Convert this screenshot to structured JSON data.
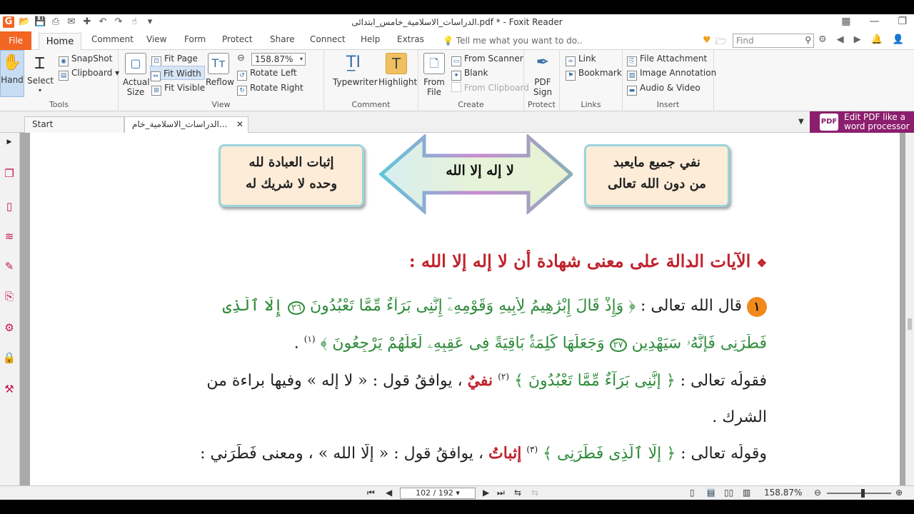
{
  "window": {
    "title": "الدراسات_الاسلامية_خامس_ابتدائى.pdf * - Foxit Reader"
  },
  "ribbon_tabs": {
    "file": "File",
    "home": "Home",
    "comment": "Comment",
    "view": "View",
    "form": "Form",
    "protect": "Protect",
    "share": "Share",
    "connect": "Connect",
    "help": "Help",
    "extras": "Extras",
    "tell_me": "Tell me what you want to do..",
    "search_placeholder": "Find"
  },
  "ribbon": {
    "tools": {
      "label": "Tools",
      "hand": "Hand",
      "select": "Select",
      "snapshot": "SnapShot",
      "clipboard": "Clipboard"
    },
    "view": {
      "label": "View",
      "actual_size": "Actual Size",
      "fit_page": "Fit Page",
      "fit_width": "Fit Width",
      "fit_visible": "Fit Visible",
      "reflow": "Reflow",
      "zoom": "158.87%",
      "rotate_left": "Rotate Left",
      "rotate_right": "Rotate Right"
    },
    "comment": {
      "label": "Comment",
      "typewriter": "Typewriter",
      "highlight": "Highlight"
    },
    "create": {
      "label": "Create",
      "from_file": "From File",
      "from_scanner": "From Scanner",
      "blank": "Blank",
      "from_clipboard": "From Clipboard"
    },
    "protect": {
      "label": "Protect",
      "pdf_sign": "PDF Sign"
    },
    "links": {
      "label": "Links",
      "link": "Link",
      "bookmark": "Bookmark"
    },
    "insert": {
      "label": "Insert",
      "file_attachment": "File Attachment",
      "image_annotation": "Image Annotation",
      "audio_video": "Audio & Video"
    }
  },
  "doc_tabs": {
    "start": "Start",
    "file": "الدراسات_الاسلامية_خام...",
    "promo_line1": "Edit PDF like a",
    "promo_line2": "word processor",
    "promo_icon": "PDF"
  },
  "page": {
    "box_left_line1": "إثبات العبادة لله",
    "box_left_line2": "وحده لا شريك له",
    "arrow_text": "لا إله إلا الله",
    "box_right_line1": "نفي جميع مايعبد",
    "box_right_line2": "من دون الله تعالى",
    "heading": "الآيات الدالة على معنى شهادة أن لا إله إلا الله :",
    "heading_marker": "❖",
    "l1_badge": "١",
    "l1_intro": "قال الله تعالى :",
    "l1_verse": "﴿ وَإِذْ قَالَ إِبْرَٰهِيمُ لِأَبِيهِ وَقَوْمِهِۦٓ إِنَّنِى بَرَآءٌ مِّمَّا تَعْبُدُونَ",
    "l1_ayah": "٢٦",
    "l1_tail": "إِلَّا ٱلَّذِى",
    "l2_verse": "فَطَرَنِى فَإِنَّهُۥ سَيَهْدِينِ",
    "l2_ayah": "٢٧",
    "l2_verse2": "وَجَعَلَهَا كَلِمَةًۢ بَاقِيَةً فِى عَقِبِهِۦ لَعَلَّهُمْ يَرْجِعُونَ ﴾",
    "l2_sup": "(١)",
    "l2_end": ".",
    "l3_intro": "فقولُه تعالى :",
    "l3_verse": "﴿ إِنَّنِى بَرَآءٌ مِّمَّا تَعْبُدُونَ ﴾",
    "l3_sup": "(٢)",
    "l3_red": "نفيٌ",
    "l3_rest": "، يوافقُ قول : « لا إله » وفيها براءة من",
    "l4_text": "الشرك .",
    "l5_intro": "وقولُه تعالى :",
    "l5_verse": "﴿ إِلَّا ٱلَّذِى فَطَرَنِى ﴾",
    "l5_sup": "(٣)",
    "l5_red": "إثباتُ",
    "l5_rest": "، يوافقُ قول : « إِلَّا الله » ، ومعنى فَطَرَني :"
  },
  "status": {
    "page_indicator": "102 / 192",
    "zoom": "158.87%"
  },
  "colors": {
    "accent_file_tab": "#f26522",
    "promo_bg": "#8b1f6e",
    "heading_red": "#c0232c",
    "verse_green": "#2e8b3a",
    "box_fill": "#fdecd8",
    "box_border": "#9ad5dc"
  }
}
